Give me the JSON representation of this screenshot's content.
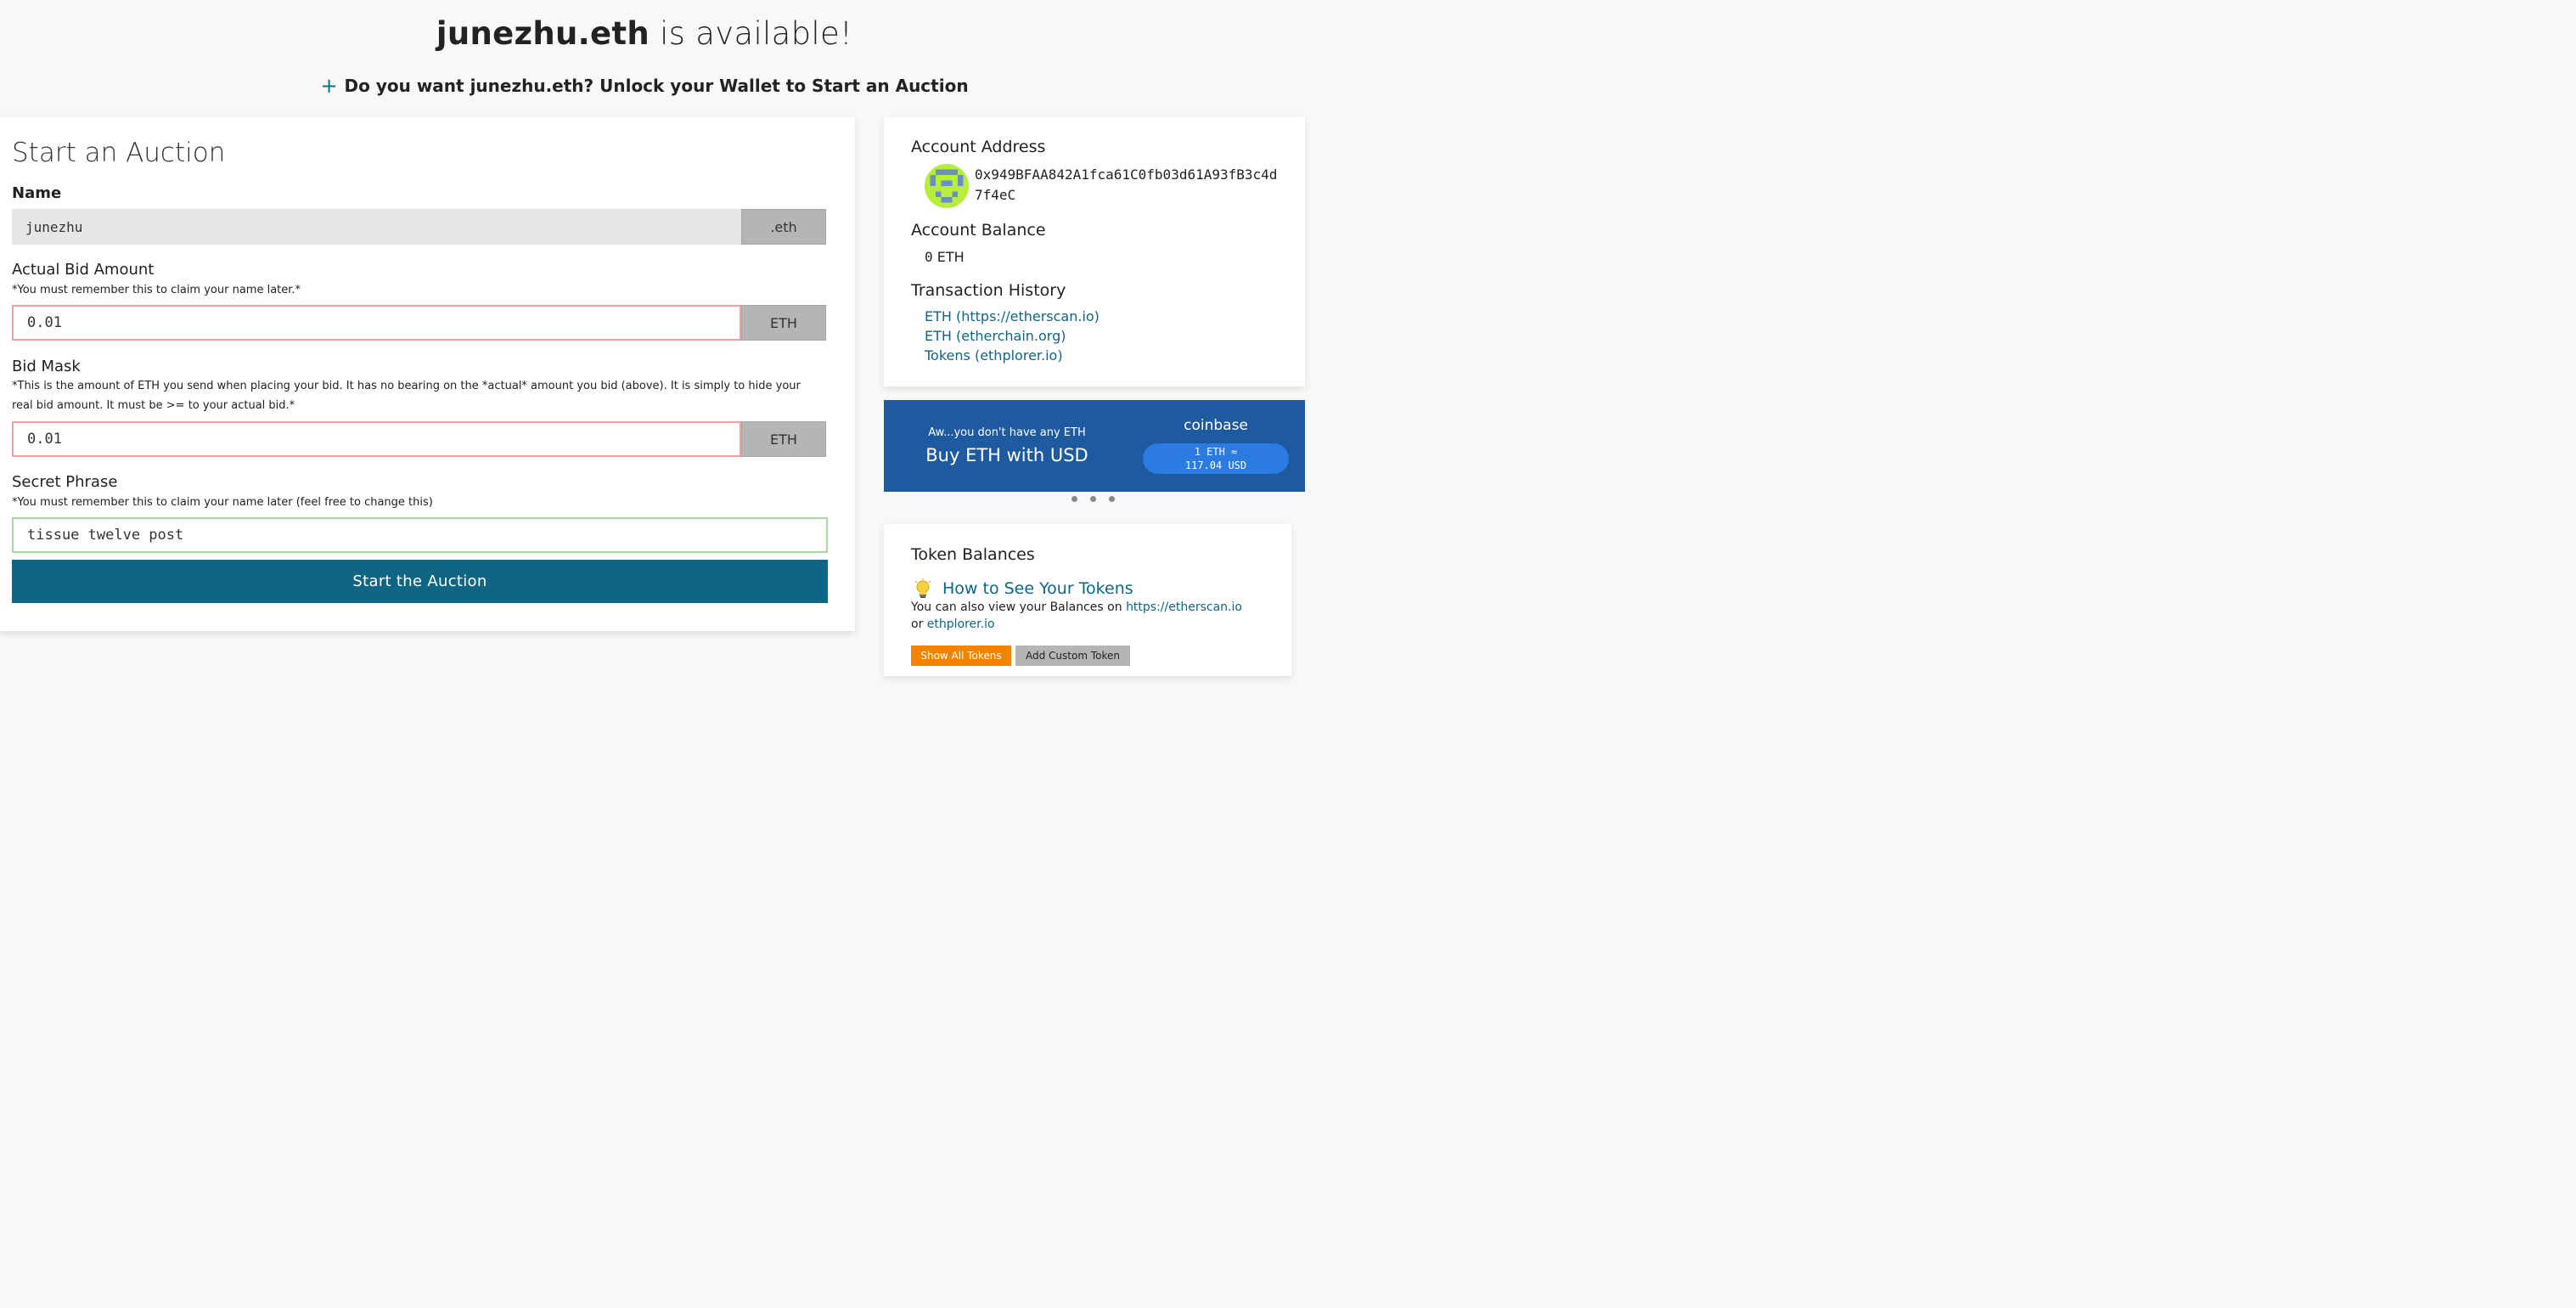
{
  "header": {
    "name": "junezhu.eth",
    "available_text": "is available!",
    "unlock_text": "Do you want junezhu.eth? Unlock your Wallet to Start an Auction"
  },
  "auction": {
    "heading": "Start an Auction",
    "name_label": "Name",
    "name_value": "junezhu",
    "name_suffix": ".eth",
    "bid_label": "Actual Bid Amount",
    "bid_note": "*You must remember this to claim your name later.*",
    "bid_value": "0.01",
    "bid_unit": "ETH",
    "mask_label": "Bid Mask",
    "mask_note": "*This is the amount of ETH you send when placing your bid. It has no bearing on the *actual* amount you bid (above). It is simply to hide your real bid amount. It must be >= to your actual bid.*",
    "mask_value": "0.01",
    "mask_unit": "ETH",
    "secret_label": "Secret Phrase",
    "secret_note": "*You must remember this to claim your name later (feel free to change this)",
    "secret_value": "tissue twelve post",
    "start_button": "Start the Auction"
  },
  "account": {
    "address_label": "Account Address",
    "address": "0x949BFAA842A1fca61C0fb03d61A93fB3c4d7f4eC",
    "balance_label": "Account Balance",
    "balance_amount": "0",
    "balance_unit": "ETH",
    "history_label": "Transaction History",
    "history_links": [
      "ETH (https://etherscan.io)",
      "ETH (etherchain.org)",
      "Tokens (ethplorer.io)"
    ]
  },
  "coinbase": {
    "small_text": "Aw...you don't have any ETH",
    "big_text": "Buy ETH with USD",
    "brand": "coinbase",
    "rate_line1": "1 ETH ≈",
    "rate_line2": "117.04 USD"
  },
  "tokens": {
    "heading": "Token Balances",
    "how_link": "How to See Your Tokens",
    "note_prefix": "You can also view your Balances on",
    "note_link1": "https://etherscan.io",
    "note_or": "or",
    "note_link2": "ethplorer.io",
    "show_all": "Show All Tokens",
    "add_custom": "Add Custom Token"
  },
  "colors": {
    "accent": "#0e6584",
    "coinbase_blue": "#1e5aa0",
    "warning_border": "#f0a0a0",
    "valid_border": "#a8d8a0",
    "orange": "#f48400"
  }
}
